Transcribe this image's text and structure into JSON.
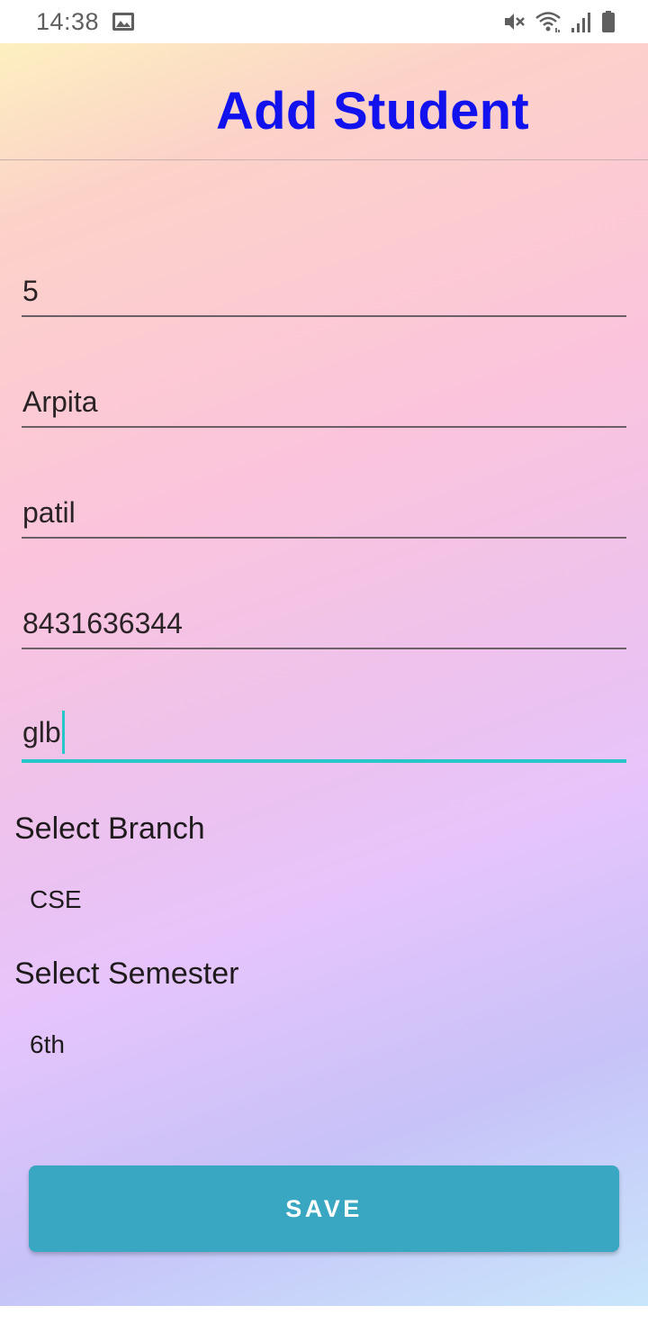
{
  "status_bar": {
    "time": "14:38",
    "icons": [
      "gallery-icon",
      "mute-icon",
      "wifi-icon",
      "signal-icon",
      "battery-icon"
    ]
  },
  "header": {
    "title": "Add Student",
    "title_color": "#1212ee"
  },
  "form": {
    "fields": [
      {
        "value": "5"
      },
      {
        "value": "Arpita"
      },
      {
        "value": "patil"
      },
      {
        "value": "8431636344"
      },
      {
        "value": "glb",
        "focused": true
      }
    ],
    "branch": {
      "label": "Select Branch",
      "value": "CSE"
    },
    "semester": {
      "label": "Select Semester",
      "value": "6th"
    }
  },
  "actions": {
    "save_label": "SAVE",
    "save_color": "#39a7c2",
    "accent_color": "#26c6c9"
  }
}
